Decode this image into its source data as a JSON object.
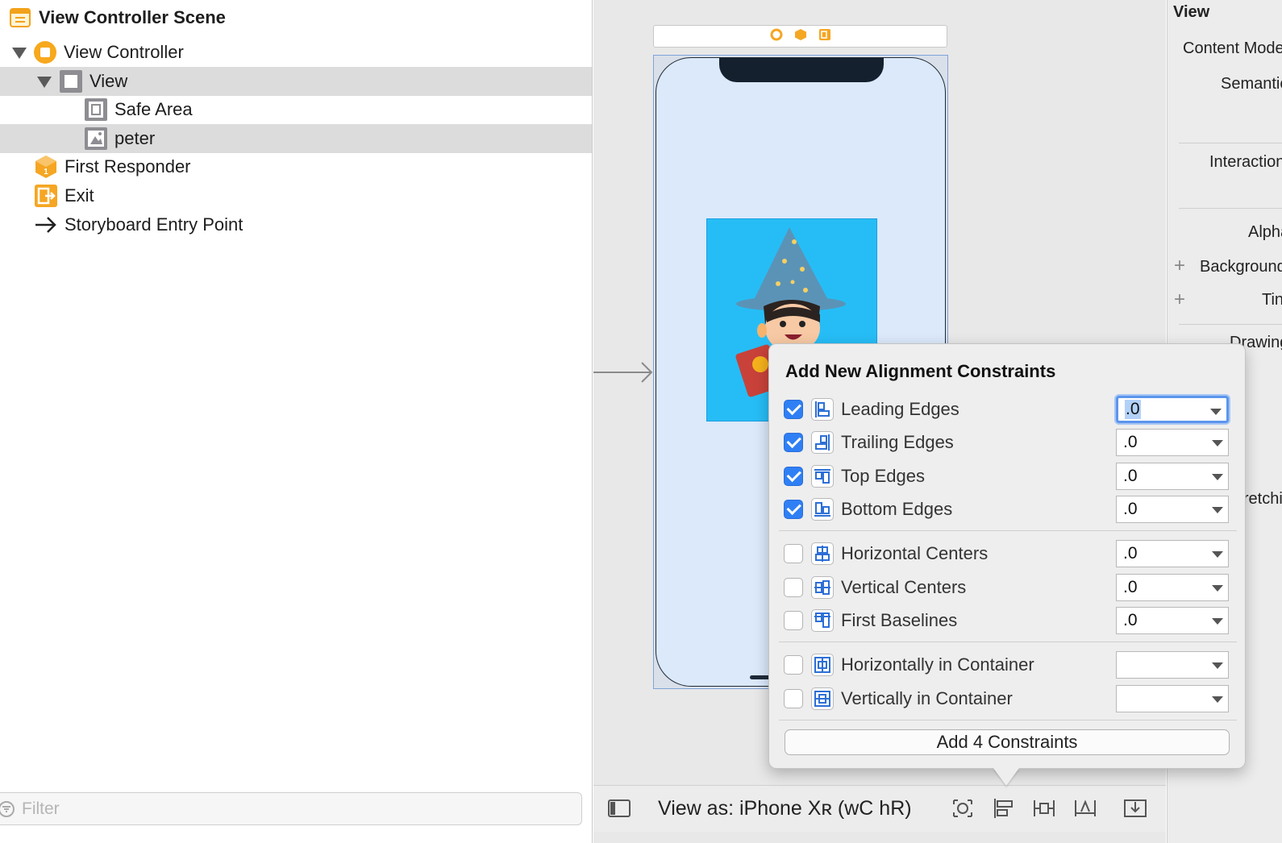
{
  "outline": {
    "scene_title": "View Controller Scene",
    "items": [
      {
        "label": "View Controller"
      },
      {
        "label": "View"
      },
      {
        "label": "Safe Area"
      },
      {
        "label": "peter"
      },
      {
        "label": "First Responder"
      },
      {
        "label": "Exit"
      },
      {
        "label": "Storyboard Entry Point"
      }
    ],
    "filter_placeholder": "Filter"
  },
  "canvas": {
    "view_as_label": "View as: iPhone Xʀ (wC hR)"
  },
  "inspector": {
    "header": "View",
    "labels": [
      "Content Mode",
      "Semantic",
      "Interaction",
      "Alpha",
      "Background",
      "Tint",
      "Drawing",
      "Stretching"
    ]
  },
  "popover": {
    "title": "Add New Alignment Constraints",
    "rows": [
      {
        "label": "Leading Edges",
        "checked": true,
        "value": ".0",
        "icon": "leading-edges-icon"
      },
      {
        "label": "Trailing Edges",
        "checked": true,
        "value": ".0",
        "icon": "trailing-edges-icon"
      },
      {
        "label": "Top Edges",
        "checked": true,
        "value": ".0",
        "icon": "top-edges-icon"
      },
      {
        "label": "Bottom Edges",
        "checked": true,
        "value": ".0",
        "icon": "bottom-edges-icon"
      },
      {
        "label": "Horizontal Centers",
        "checked": false,
        "value": ".0",
        "icon": "horizontal-centers-icon"
      },
      {
        "label": "Vertical Centers",
        "checked": false,
        "value": ".0",
        "icon": "vertical-centers-icon"
      },
      {
        "label": "First Baselines",
        "checked": false,
        "value": ".0",
        "icon": "first-baselines-icon"
      },
      {
        "label": "Horizontally in Container",
        "checked": false,
        "value": "",
        "icon": "horizontally-in-container-icon"
      },
      {
        "label": "Vertically in Container",
        "checked": false,
        "value": "",
        "icon": "vertically-in-container-icon"
      }
    ],
    "add_button": "Add 4 Constraints"
  },
  "colors": {
    "accent": "#2f7ff5",
    "storyboard_orange": "#f5a623",
    "image_blue": "#26bdf6"
  }
}
